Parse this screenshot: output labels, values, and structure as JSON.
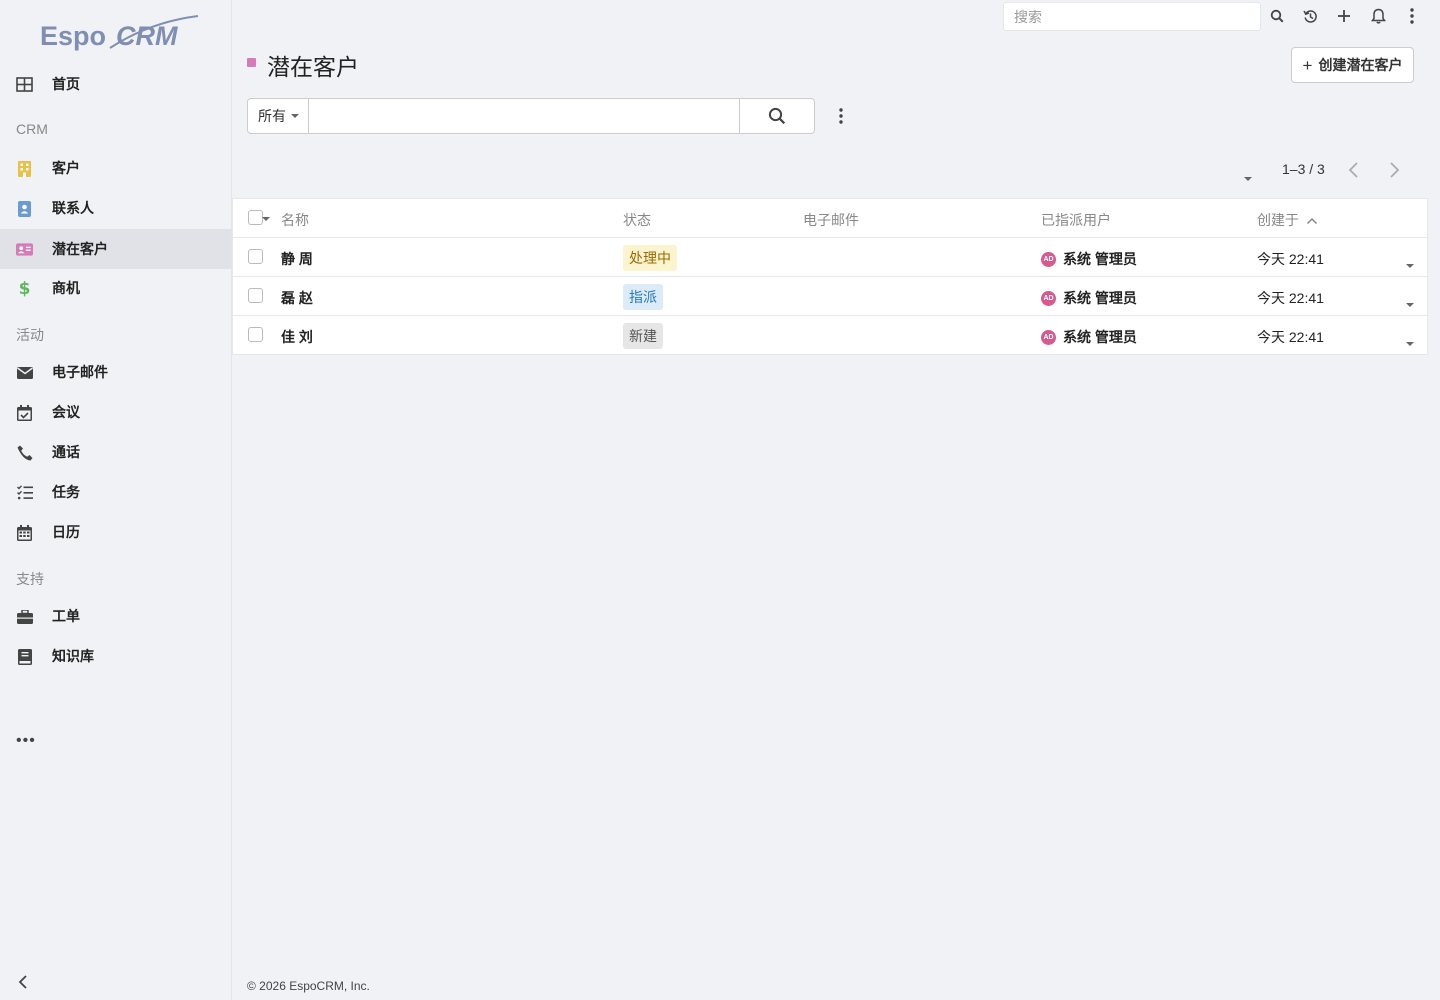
{
  "app": {
    "logo_text": "EspoCRM"
  },
  "sidebar": {
    "home": "首页",
    "groups": {
      "crm": "CRM",
      "activities": "活动",
      "support": "支持"
    },
    "items": [
      {
        "label": "客户",
        "icon": "building-icon",
        "color": "#e8c14a"
      },
      {
        "label": "联系人",
        "icon": "contact-book-icon",
        "color": "#6b9bd2"
      },
      {
        "label": "潜在客户",
        "icon": "id-card-icon",
        "color": "#d57bba",
        "active": true
      },
      {
        "label": "商机",
        "icon": "dollar-icon",
        "color": "#5cb85c"
      },
      {
        "label": "电子邮件",
        "icon": "envelope-icon",
        "color": "#555"
      },
      {
        "label": "会议",
        "icon": "calendar-check-icon",
        "color": "#555"
      },
      {
        "label": "通话",
        "icon": "phone-icon",
        "color": "#555"
      },
      {
        "label": "任务",
        "icon": "tasks-icon",
        "color": "#555"
      },
      {
        "label": "日历",
        "icon": "calendar-icon",
        "color": "#555"
      },
      {
        "label": "工单",
        "icon": "briefcase-icon",
        "color": "#555"
      },
      {
        "label": "知识库",
        "icon": "book-icon",
        "color": "#555"
      }
    ],
    "more": "•••"
  },
  "topbar": {
    "search_placeholder": "搜索"
  },
  "header": {
    "title": "潜在客户",
    "title_color": "#d57bba",
    "create_button": "创建潜在客户"
  },
  "filter": {
    "preset": "所有",
    "text_value": ""
  },
  "pagination": {
    "text": "1–3 / 3"
  },
  "table": {
    "columns": {
      "name": "名称",
      "status": "状态",
      "email": "电子邮件",
      "assigned_user": "已指派用户",
      "created_at": "创建于"
    },
    "rows": [
      {
        "name": "静 周",
        "status": "处理中",
        "status_bg": "#fcf3cf",
        "status_color": "#9a6b00",
        "email": "",
        "user_initials": "AD",
        "user": "系统 管理员",
        "created": "今天 22:41"
      },
      {
        "name": "磊 赵",
        "status": "指派",
        "status_bg": "#dcebf8",
        "status_color": "#2a7ab8",
        "email": "",
        "user_initials": "AD",
        "user": "系统 管理员",
        "created": "今天 22:41"
      },
      {
        "name": "佳 刘",
        "status": "新建",
        "status_bg": "#e6e6e6",
        "status_color": "#555",
        "email": "",
        "user_initials": "AD",
        "user": "系统 管理员",
        "created": "今天 22:41"
      }
    ]
  },
  "footer": {
    "text": "© 2026 EspoCRM, Inc."
  }
}
